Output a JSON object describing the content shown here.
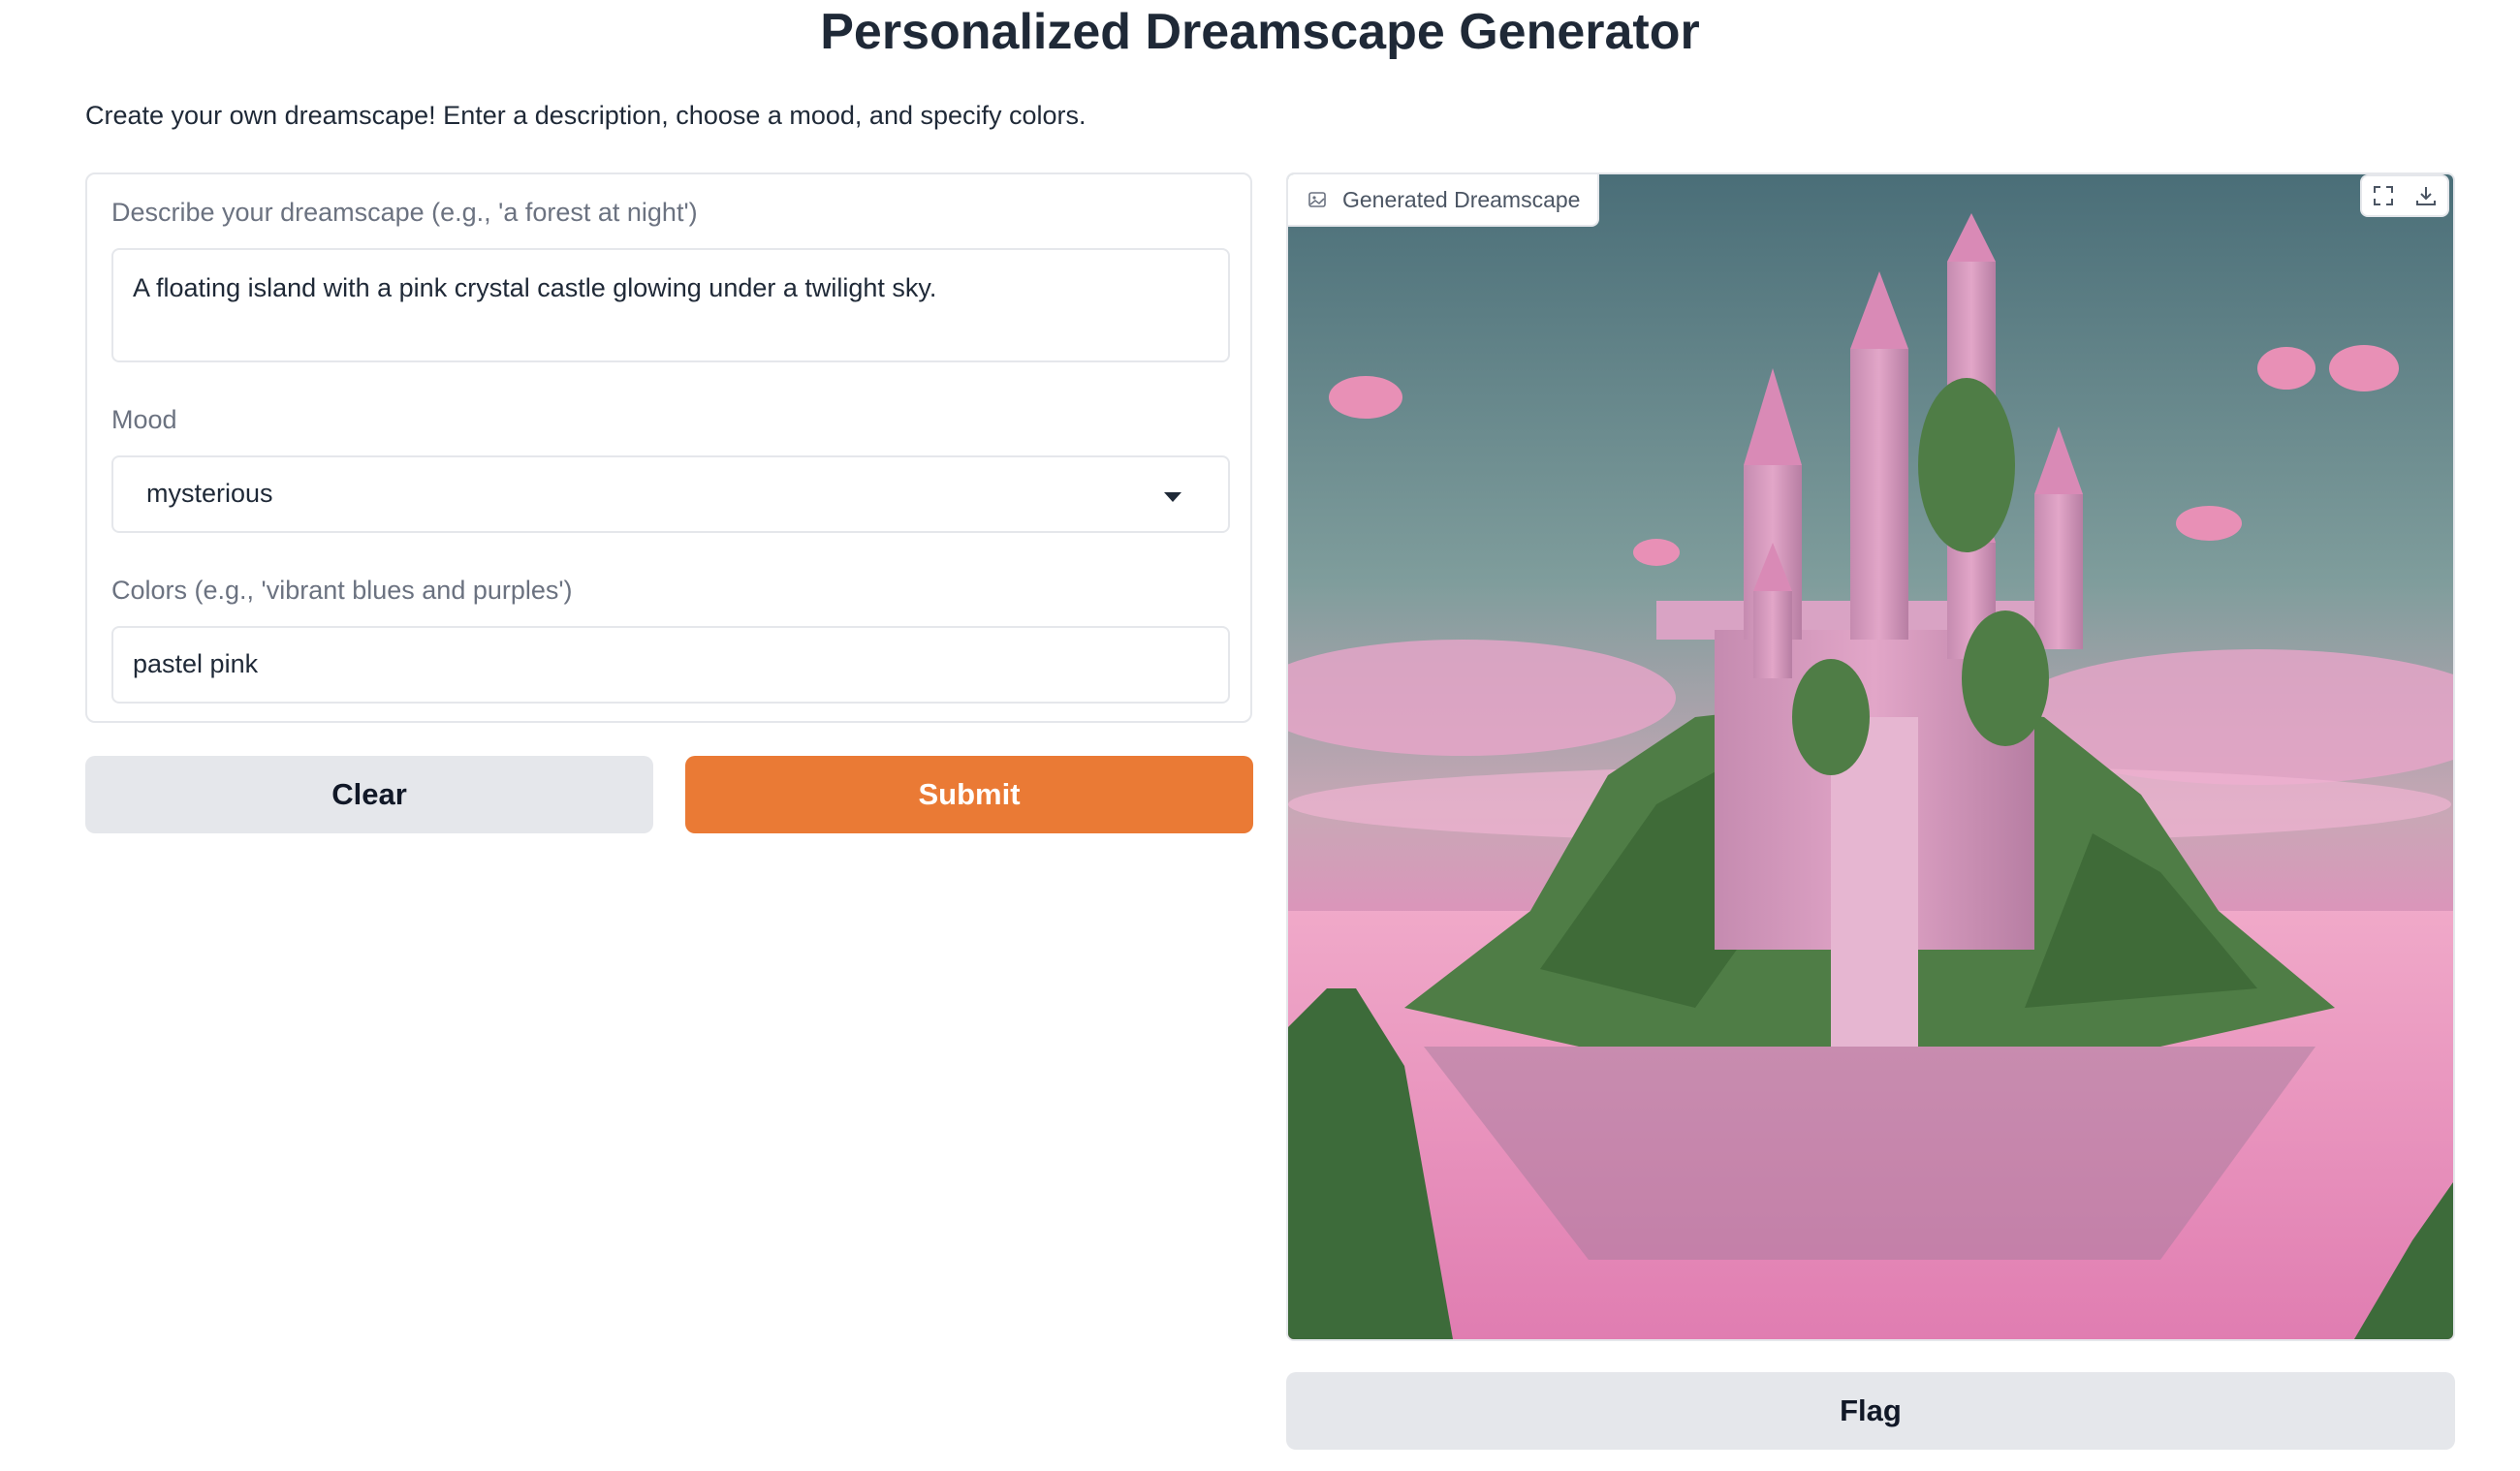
{
  "app": {
    "title": "Personalized Dreamscape Generator",
    "description": "Create your own dreamscape! Enter a description, choose a mood, and specify colors."
  },
  "inputs": {
    "description": {
      "label": "Describe your dreamscape (e.g., 'a forest at night')",
      "value": "A floating island with a pink crystal castle glowing under a twilight sky."
    },
    "mood": {
      "label": "Mood",
      "value": "mysterious"
    },
    "colors": {
      "label": "Colors (e.g., 'vibrant blues and purples')",
      "value": "pastel pink"
    }
  },
  "buttons": {
    "clear": "Clear",
    "submit": "Submit",
    "flag": "Flag"
  },
  "output": {
    "label": "Generated Dreamscape",
    "icons": [
      "image-icon",
      "fullscreen-icon",
      "download-icon"
    ]
  },
  "colors": {
    "accent": "#ea7a35",
    "secondary_button": "#e5e7eb",
    "border": "#e5e7eb"
  }
}
